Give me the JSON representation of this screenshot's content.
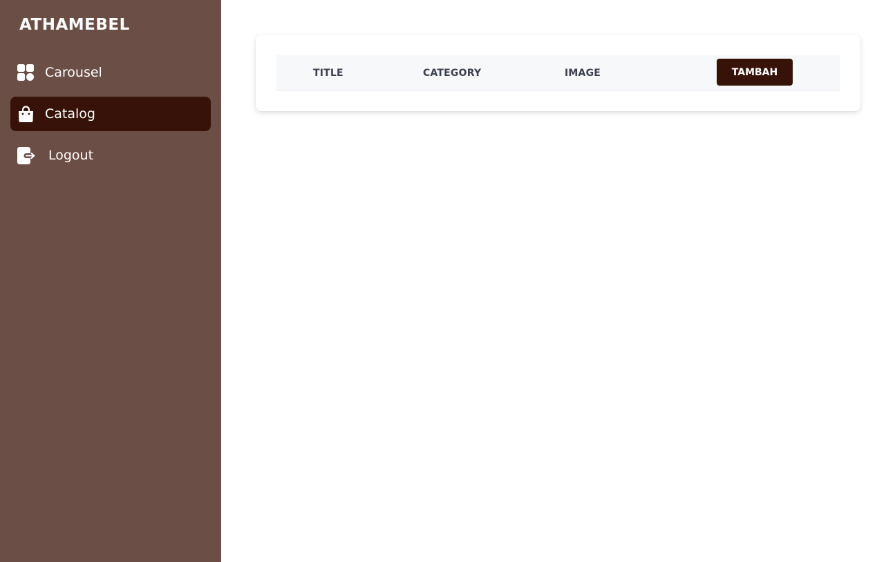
{
  "sidebar": {
    "brand": "ATHAMEBEL",
    "background": "#6b4e45",
    "active_color": "#371208",
    "items": [
      {
        "label": "Carousel",
        "icon": "grid-icon",
        "active": false
      },
      {
        "label": "Catalog",
        "icon": "shopping-bag-icon",
        "active": true
      },
      {
        "label": "Logout",
        "icon": "logout-icon",
        "active": false
      }
    ]
  },
  "table": {
    "columns": [
      "TITLE",
      "CATEGORY",
      "IMAGE"
    ],
    "add_button_label": "TAMBAH",
    "rows": []
  }
}
